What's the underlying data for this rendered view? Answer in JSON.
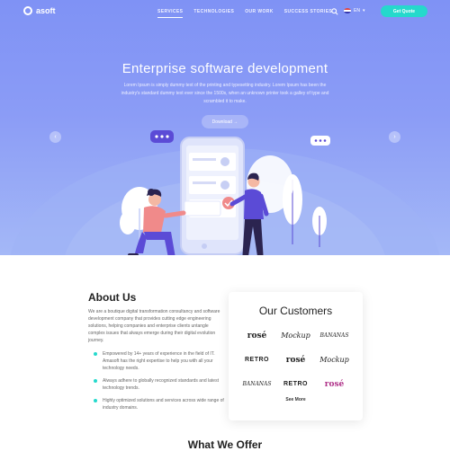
{
  "brand": {
    "name": "asoft"
  },
  "nav": {
    "items": [
      "SERVICES",
      "TECHNOLOGIES",
      "OUR WORK",
      "SUCCESS STORIES"
    ],
    "language": "EN",
    "cta": "Get Quote"
  },
  "hero": {
    "title": "Enterprise software development",
    "description": "Lorem Ipsum is simply dummy text of the printing and typesetting industry. Lorem Ipsum has been the industry's standard dummy text ever since the 1500s, when an unknown printer took a galley of type and scrambled it to make.",
    "button": "Download",
    "prev": "‹",
    "next": "›"
  },
  "about": {
    "title": "About Us",
    "text": "We are a boutique digital transformation consultancy and software development company that provides cutting edge engineering solutions, helping companies and enterprise clients untangle complex issues that always emerge during their digital evolution journey.",
    "bullets": [
      "Empowered by 14+ years of experience in the field of IT. Amasoft has the right expertise to help you with all your technology needs.",
      "Always adhere to globally recognized standards and latest technology trends.",
      "Highly optimized solutions and services across wide range of industry domains."
    ]
  },
  "customers": {
    "title": "Our Customers",
    "logos": [
      "rosé",
      "Mockup",
      "BANANAS",
      "RETRO",
      "rosé",
      "Mockup",
      "BANANAS",
      "RETRO",
      "rosé"
    ],
    "see_more": "See More"
  },
  "offer": {
    "title": "What We Offer"
  },
  "colors": {
    "accent": "#25d9cc",
    "hero_top": "#7f92f5",
    "figure": "#5b4bd6",
    "figure_pink": "#f08a8a"
  }
}
